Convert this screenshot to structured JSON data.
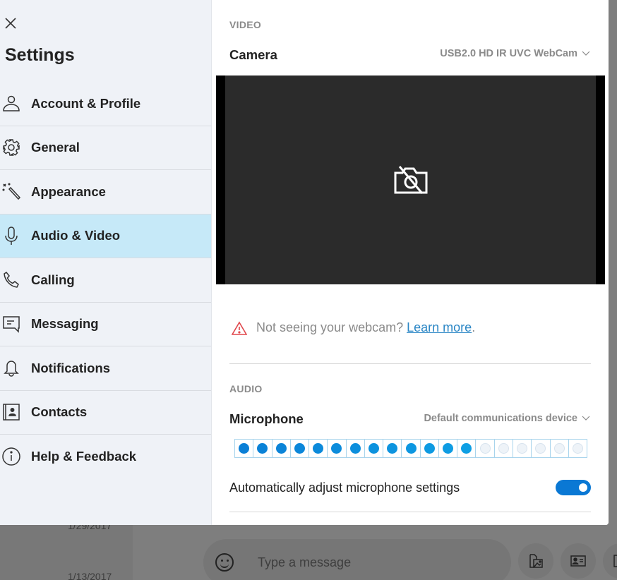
{
  "background": {
    "dates": [
      "1/29/2017",
      "1/13/2017"
    ],
    "composer_placeholder": "Type a message"
  },
  "settings": {
    "title": "Settings",
    "nav": [
      {
        "label": "Account & Profile",
        "icon": "person-icon",
        "active": false
      },
      {
        "label": "General",
        "icon": "gear-icon",
        "active": false
      },
      {
        "label": "Appearance",
        "icon": "magic-wand-icon",
        "active": false
      },
      {
        "label": "Audio & Video",
        "icon": "microphone-icon",
        "active": true
      },
      {
        "label": "Calling",
        "icon": "phone-icon",
        "active": false
      },
      {
        "label": "Messaging",
        "icon": "chat-icon",
        "active": false
      },
      {
        "label": "Notifications",
        "icon": "bell-icon",
        "active": false
      },
      {
        "label": "Contacts",
        "icon": "contact-card-icon",
        "active": false
      },
      {
        "label": "Help & Feedback",
        "icon": "info-icon",
        "active": false
      }
    ]
  },
  "video": {
    "section_label": "VIDEO",
    "camera_label": "Camera",
    "camera_device": "USB2.0 HD IR UVC WebCam",
    "warning_text": "Not seeing your webcam? ",
    "warning_link": "Learn more",
    "warning_suffix": "."
  },
  "audio": {
    "section_label": "AUDIO",
    "microphone_label": "Microphone",
    "microphone_device": "Default communications device",
    "mic_level": {
      "active": 13,
      "total": 19
    },
    "auto_adjust_label": "Automatically adjust microphone settings",
    "auto_adjust_enabled": true
  },
  "colors": {
    "accent": "#0a78d4",
    "active_nav": "#c6e9f8",
    "link": "#2a86c5",
    "warning": "#e0474c"
  }
}
